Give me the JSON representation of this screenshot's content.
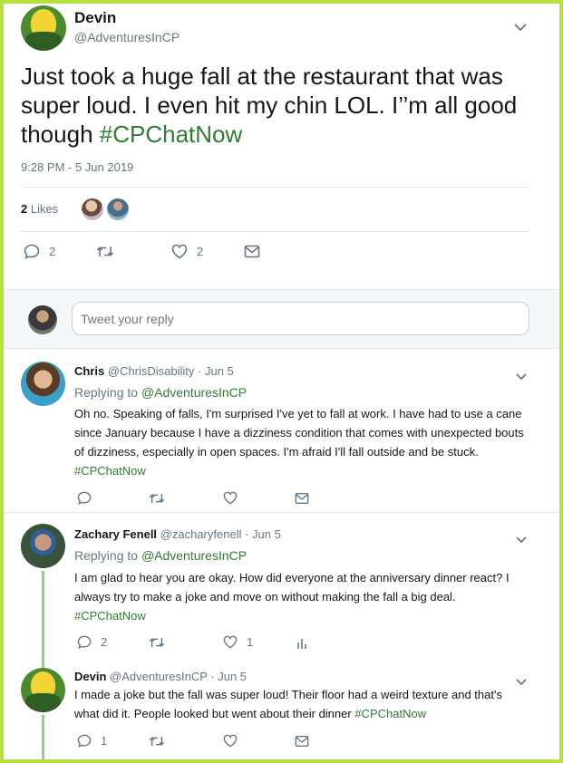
{
  "main_tweet": {
    "name": "Devin",
    "handle": "@AdventuresInCP",
    "text": "Just took a huge fall at the restaurant that was super loud. I even hit my chin LOL. I’’m all good though ",
    "hashtag": "#CPChatNow",
    "timestamp": "9:28 PM - 5 Jun 2019",
    "likes_count": "2",
    "likes_label": "Likes",
    "actions": {
      "reply_count": "2",
      "retweet_count": "",
      "like_count": "2"
    }
  },
  "reply_box": {
    "placeholder": "Tweet your reply"
  },
  "replies": [
    {
      "name": "Chris",
      "handle": "@ChrisDisability",
      "date": "· Jun 5",
      "replying_label": "Replying to ",
      "replying_to": "@AdventuresInCP",
      "text": "Oh no. Speaking of falls, I'm surprised I've yet to fall at work. I have had to use a cane since January because I have a dizziness condition that comes with unexpected bouts of dizziness, especially in open spaces. I'm afraid I'll fall outside and be stuck. ",
      "hashtag": "#CPChatNow",
      "actions": {
        "reply_count": "",
        "retweet_count": "",
        "like_count": ""
      }
    },
    {
      "name": "Zachary Fenell",
      "handle": "@zacharyfenell",
      "date": "· Jun 5",
      "replying_label": "Replying to ",
      "replying_to": "@AdventuresInCP",
      "text": "I am glad to hear you are okay. How did everyone at the anniversary dinner react? I always try to make a joke and move on without making the fall a big deal. ",
      "hashtag": "#CPChatNow",
      "actions": {
        "reply_count": "2",
        "retweet_count": "",
        "like_count": "1"
      }
    },
    {
      "name": "Devin",
      "handle": "@AdventuresInCP",
      "date": "· Jun 5",
      "text": "I made a joke but the fall was super loud! Their floor had a weird texture and that's what did it. People looked but went about their dinner ",
      "hashtag": "#CPChatNow",
      "actions": {
        "reply_count": "1",
        "retweet_count": "",
        "like_count": ""
      }
    }
  ],
  "colors": {
    "accent": "#2f7d32",
    "border": "#b7e13d",
    "muted": "#657786"
  },
  "icons": [
    "reply-icon",
    "retweet-icon",
    "like-icon",
    "message-icon",
    "analytics-icon",
    "chevron-down-icon"
  ]
}
